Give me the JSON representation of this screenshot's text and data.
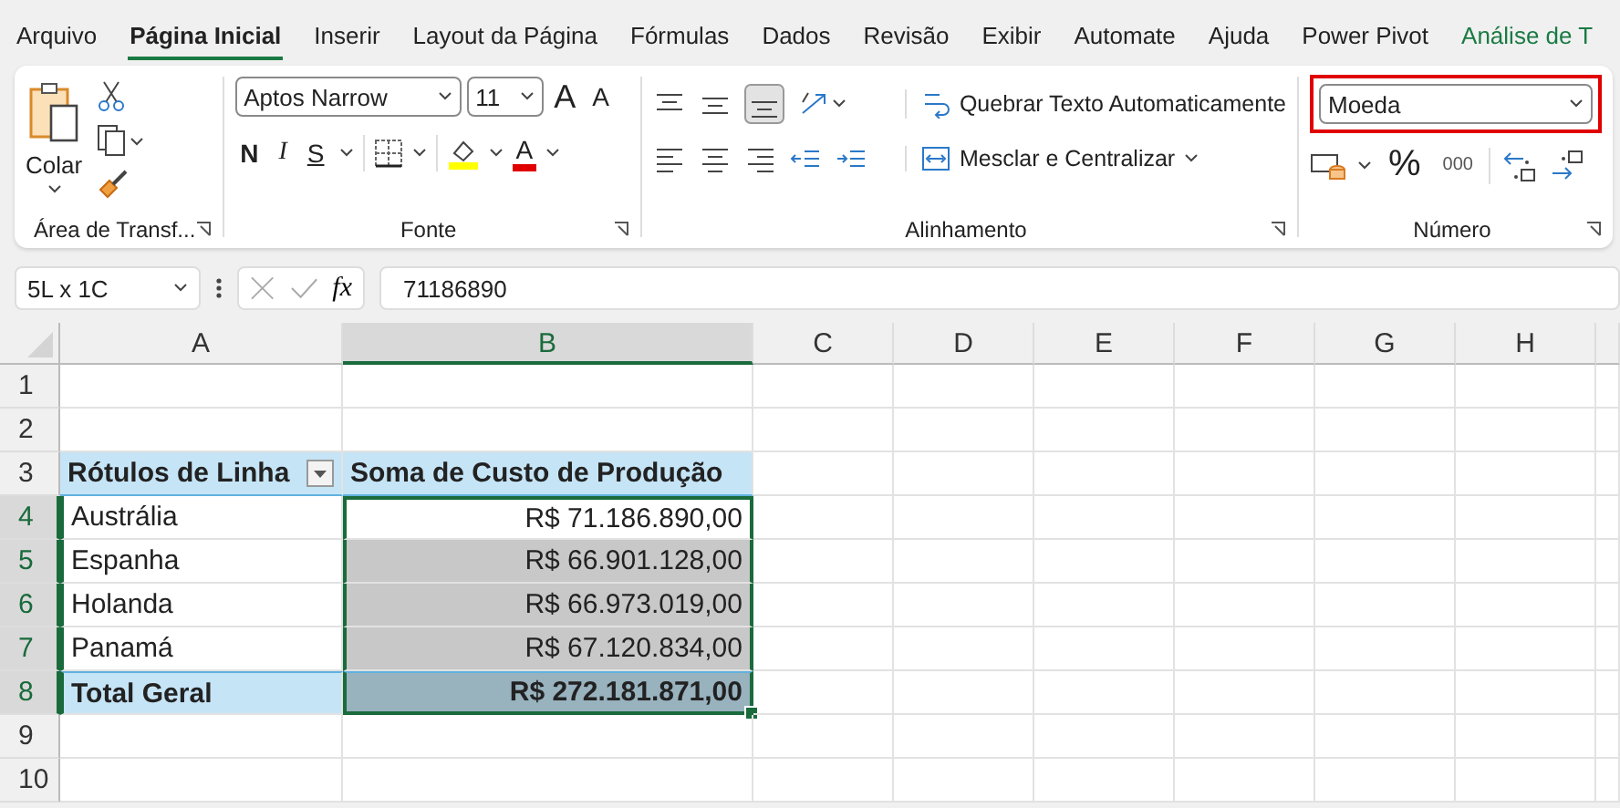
{
  "menu_tabs": [
    {
      "label": "Arquivo",
      "selected": false
    },
    {
      "label": "Página Inicial",
      "selected": true
    },
    {
      "label": "Inserir",
      "selected": false
    },
    {
      "label": "Layout da Página",
      "selected": false
    },
    {
      "label": "Fórmulas",
      "selected": false
    },
    {
      "label": "Dados",
      "selected": false
    },
    {
      "label": "Revisão",
      "selected": false
    },
    {
      "label": "Exibir",
      "selected": false
    },
    {
      "label": "Automate",
      "selected": false
    },
    {
      "label": "Ajuda",
      "selected": false
    },
    {
      "label": "Power Pivot",
      "selected": false
    },
    {
      "label": "Análise de T",
      "selected": false,
      "kind": "contextual"
    }
  ],
  "ribbon": {
    "clipboard": {
      "paste_label": "Colar",
      "group_label": "Área de Transf..."
    },
    "font": {
      "font_name": "Aptos Narrow",
      "font_size": "11",
      "grow_font": "A",
      "shrink_font": "A",
      "bold": "N",
      "italic": "I",
      "underline": "S",
      "font_color": "A",
      "group_label": "Fonte"
    },
    "alignment": {
      "wrap_text": "Quebrar Texto Automaticamente",
      "merge_center": "Mesclar e Centralizar",
      "group_label": "Alinhamento"
    },
    "number": {
      "format": "Moeda",
      "highlighted": true,
      "percent": "%",
      "thousands": "000",
      "group_label": "Número"
    }
  },
  "formula_bar": {
    "name_box": "5L x 1C",
    "fx": "fx",
    "formula": "71186890"
  },
  "sheet": {
    "columns": [
      {
        "label": "A",
        "selected": false
      },
      {
        "label": "B",
        "selected": true
      },
      {
        "label": "C",
        "selected": false
      },
      {
        "label": "D",
        "selected": false
      },
      {
        "label": "E",
        "selected": false
      },
      {
        "label": "F",
        "selected": false
      },
      {
        "label": "G",
        "selected": false
      },
      {
        "label": "H",
        "selected": false
      }
    ],
    "rows": [
      {
        "label": "1",
        "selected": false
      },
      {
        "label": "2",
        "selected": false
      },
      {
        "label": "3",
        "selected": false
      },
      {
        "label": "4",
        "selected": true
      },
      {
        "label": "5",
        "selected": true
      },
      {
        "label": "6",
        "selected": true
      },
      {
        "label": "7",
        "selected": true
      },
      {
        "label": "8",
        "selected": true
      },
      {
        "label": "9",
        "selected": false
      },
      {
        "label": "10",
        "selected": false
      }
    ],
    "pivot": {
      "row_header": "Rótulos de Linha",
      "value_header": "Soma de Custo de Produção",
      "rows": [
        {
          "label": "Austrália",
          "value": "R$ 71.186.890,00",
          "selected": true,
          "active": true
        },
        {
          "label": "Espanha",
          "value": "R$ 66.901.128,00",
          "selected": true,
          "active": false
        },
        {
          "label": "Holanda",
          "value": "R$ 66.973.019,00",
          "selected": true,
          "active": false
        },
        {
          "label": "Panamá",
          "value": "R$ 67.120.834,00",
          "selected": true,
          "active": false
        }
      ],
      "total": {
        "label": "Total Geral",
        "value": "R$ 272.181.871,00",
        "selected": true
      }
    }
  }
}
